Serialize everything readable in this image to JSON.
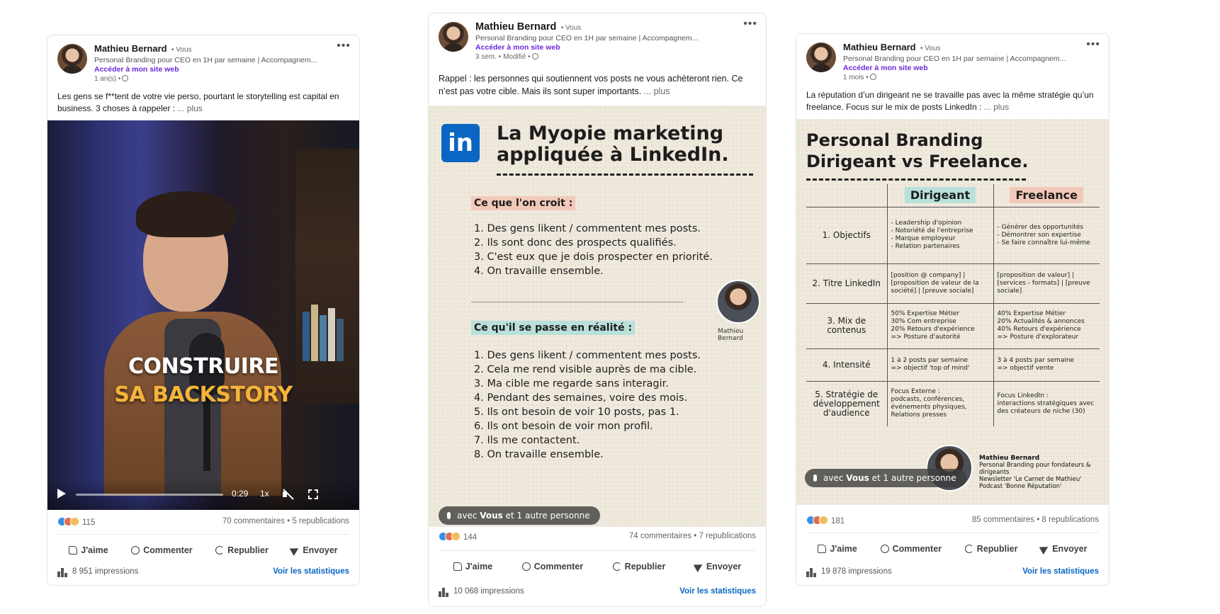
{
  "posts": [
    {
      "author": "Mathieu Bernard",
      "badge": "• Vous",
      "headline": "Personal Branding pour CEO en 1H par semaine | Accompagnem...",
      "site_link": "Accéder à mon site web",
      "meta": "1 an(s) •",
      "text": "Les gens se f**tent de votre vie perso, pourtant le storytelling est capital en business. 3 choses à rappeler :",
      "more": "... plus",
      "video": {
        "line1": "CONSTRUIRE",
        "line2": "SA BACKSTORY",
        "time": "0:29",
        "speed": "1x"
      },
      "reactions": "115",
      "social_counts": "70 commentaires • 5 republications",
      "actions": {
        "like": "J'aime",
        "comment": "Commenter",
        "repost": "Republier",
        "send": "Envoyer"
      },
      "impressions": "8 951 impressions",
      "stats_link": "Voir les statistiques"
    },
    {
      "author": "Mathieu Bernard",
      "badge": "• Vous",
      "headline": "Personal Branding pour CEO en 1H par semaine | Accompagnem...",
      "site_link": "Accéder à mon site web",
      "meta": "3 sem. • Modifié •",
      "text": "Rappel : les personnes qui soutiennent vos posts ne vous achèteront rien. Ce n’est pas votre cible. Mais ils sont super importants.",
      "more": "... plus",
      "image": {
        "logo": "in",
        "title_line1": "La Myopie marketing",
        "title_line2": "appliquée à LinkedIn.",
        "section1": "Ce que l'on croit :",
        "list1": [
          "1. Des gens likent / commentent mes posts.",
          "2. Ils sont donc des prospects qualifiés.",
          "3. C'est eux que je dois prospecter en priorité.",
          "4. On travaille ensemble."
        ],
        "section2": "Ce qu'il se passe en réalité :",
        "list2": [
          "1. Des gens likent / commentent mes posts.",
          "2. Cela me rend visible auprès de ma cible.",
          "3. Ma cible me regarde sans interagir.",
          "4. Pendant des semaines, voire des mois.",
          "5. Ils ont besoin de voir 10 posts, pas 1.",
          "6. Ils ont besoin de voir mon profil.",
          "7. Ils me contactent.",
          "8. On travaille ensemble."
        ],
        "caption": "Mathieu Bernard"
      },
      "tag": {
        "prefix": "avec",
        "bold": "Vous",
        "suffix": "et 1 autre personne"
      },
      "reactions": "144",
      "social_counts": "74 commentaires • 7 republications",
      "actions": {
        "like": "J'aime",
        "comment": "Commenter",
        "repost": "Republier",
        "send": "Envoyer"
      },
      "impressions": "10 068 impressions",
      "stats_link": "Voir les statistiques"
    },
    {
      "author": "Mathieu Bernard",
      "badge": "• Vous",
      "headline": "Personal Branding pour CEO en 1H par semaine | Accompagnem...",
      "site_link": "Accéder à mon site web",
      "meta": "1 mois •",
      "text": "La réputation d’un dirigeant ne se travaille pas avec la même stratégie qu’un freelance. Focus sur le mix de posts LinkedIn :",
      "more": "... plus",
      "image": {
        "title_line1": "Personal Branding",
        "title_line2": "Dirigeant vs Freelance.",
        "col1": "Dirigeant",
        "col2": "Freelance",
        "rows": [
          {
            "label": "1. Objectifs",
            "a": "- Leadership d'opinion\n- Notoriété de l'entreprise\n- Marque employeur\n- Relation partenaires",
            "b": "- Générer des opportunités\n- Démontrer son expertise\n- Se faire connaître lui-même"
          },
          {
            "label": "2. Titre LinkedIn",
            "a": "[position @ company] | [proposition de valeur de la société] | [preuve sociale]",
            "b": "[proposition de valeur] | [services - formats] | [preuve sociale]"
          },
          {
            "label": "3. Mix de contenus",
            "a": "50% Expertise Métier\n30% Com entreprise\n20% Retours d'expérience\n=> Posture d'autorité",
            "b": "40% Expertise Métier\n20% Actualités & annonces\n40% Retours d'expérience\n=> Posture d'explorateur"
          },
          {
            "label": "4. Intensité",
            "a": "1 à 2 posts par semaine\n=> objectif 'top of mind'",
            "b": "3 à 4 posts par semaine\n=> objectif vente"
          },
          {
            "label": "5. Stratégie de développement d'audience",
            "a": "Focus Externe :\npodcasts, conférences, événements physiques, Relations presses",
            "b": "Focus LinkedIn :\ninteractions stratégiques avec des créateurs de niche (30)"
          }
        ],
        "sig_name": "Mathieu Bernard",
        "sig_lines": [
          "Personal Branding pour fondateurs & dirigeants",
          "Newsletter 'Le Carnet de Mathieu'",
          "Podcast 'Bonne Réputation'"
        ]
      },
      "tag": {
        "prefix": "avec",
        "bold": "Vous",
        "suffix": "et 1 autre personne"
      },
      "reactions": "181",
      "social_counts": "85 commentaires • 8 republications",
      "actions": {
        "like": "J'aime",
        "comment": "Commenter",
        "repost": "Republier",
        "send": "Envoyer"
      },
      "impressions": "19 878 impressions",
      "stats_link": "Voir les statistiques"
    }
  ]
}
